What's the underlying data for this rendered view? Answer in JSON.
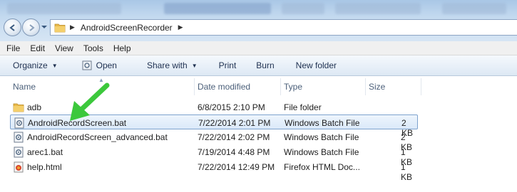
{
  "address": {
    "path_segment": "AndroidScreenRecorder"
  },
  "menu": [
    "File",
    "Edit",
    "View",
    "Tools",
    "Help"
  ],
  "toolbar": {
    "organize": "Organize",
    "open": "Open",
    "share_with": "Share with",
    "print": "Print",
    "burn": "Burn",
    "new_folder": "New folder"
  },
  "columns": {
    "name": "Name",
    "date_modified": "Date modified",
    "type": "Type",
    "size": "Size"
  },
  "files": [
    {
      "name": "adb",
      "date": "6/8/2015 2:10 PM",
      "type": "File folder",
      "size": "",
      "icon": "folder-icon"
    },
    {
      "name": "AndroidRecordScreen.bat",
      "date": "7/22/2014 2:01 PM",
      "type": "Windows Batch File",
      "size": "2 KB",
      "icon": "batch-file-icon",
      "selected": true
    },
    {
      "name": "AndroidRecordScreen_advanced.bat",
      "date": "7/22/2014 2:02 PM",
      "type": "Windows Batch File",
      "size": "2 KB",
      "icon": "batch-file-icon"
    },
    {
      "name": "arec1.bat",
      "date": "7/19/2014 4:48 PM",
      "type": "Windows Batch File",
      "size": "1 KB",
      "icon": "batch-file-icon"
    },
    {
      "name": "help.html",
      "date": "7/22/2014 12:49 PM",
      "type": "Firefox HTML Doc...",
      "size": "1 KB",
      "icon": "html-file-icon"
    }
  ],
  "colors": {
    "selection_border": "#7da2ce",
    "arrow": "#3cc83c",
    "folder": "#e8b84a"
  }
}
